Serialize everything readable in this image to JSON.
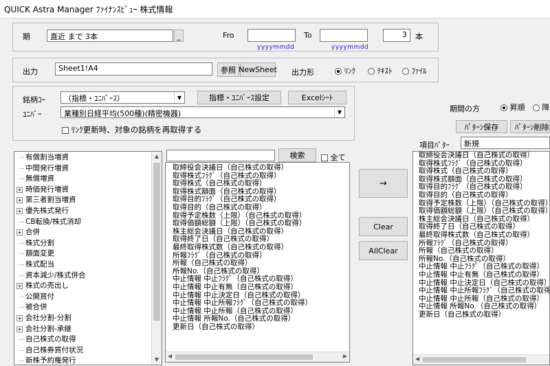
{
  "window": {
    "title": "QUICK Astra Manager ﾌｧｲﾅﾝｽﾋﾞｭｰ 株式情報"
  },
  "period": {
    "label": "期",
    "value": "直近 まで 3本",
    "picker_button": "_",
    "from_label": "Fro",
    "from_value": "",
    "from_hint": "yyyymmdd",
    "to_label": "To",
    "to_value": "",
    "to_hint": "yyyymmdd",
    "count_value": "3",
    "count_unit": "本"
  },
  "output": {
    "label": "出力",
    "value": "Sheet1!A4",
    "browse_button": "参照",
    "newsheet_button": "NewSheet",
    "format_label": "出力形",
    "format_options": [
      "ﾘﾝｸ",
      "ﾃｷｽﾄ",
      "ﾌｧｲﾙ"
    ],
    "format_selected": "ﾘﾝｸ"
  },
  "security": {
    "code_label": "銘柄ｺｰ",
    "code_value": "（指標・ﾕﾆﾊﾞｰｽ）",
    "universe_setting_button": "指標・ﾕﾆﾊﾞｰｽ設定",
    "excel_sheet_button": "Excelｼｰﾄ",
    "universe_label": "ﾕﾆﾊﾞｰ",
    "universe_value": "業種別日経平均(500種)(精密機器)",
    "reacquire_label": "ﾘﾝｸ更新時、対象の銘柄を再取得する"
  },
  "order": {
    "label": "期間の方",
    "options": [
      "昇順",
      "降"
    ],
    "selected": "昇順",
    "save_pattern_button": "ﾊﾟﾀｰﾝ保存",
    "delete_pattern_button": "ﾊﾟﾀｰﾝ削除",
    "item_pattern_label": "項目ﾊﾟﾀｰ",
    "item_pattern_value": "新規"
  },
  "search": {
    "value": "",
    "button": "検索",
    "all_label": "全て"
  },
  "tree": {
    "items": [
      {
        "label": "有償割当増資",
        "expandable": false
      },
      {
        "label": "中間発行増資",
        "expandable": false
      },
      {
        "label": "無償増資",
        "expandable": false
      },
      {
        "label": "時価発行増資",
        "expandable": true
      },
      {
        "label": "第三者割当増資",
        "expandable": true
      },
      {
        "label": "優先株式発行",
        "expandable": true
      },
      {
        "label": "CB転換/株式消却",
        "expandable": false
      },
      {
        "label": "合併",
        "expandable": true
      },
      {
        "label": "株式分割",
        "expandable": false
      },
      {
        "label": "額面変更",
        "expandable": false
      },
      {
        "label": "株式配当",
        "expandable": false
      },
      {
        "label": "資本減少/株式併合",
        "expandable": false
      },
      {
        "label": "株式の売出し",
        "expandable": true
      },
      {
        "label": "公開買付",
        "expandable": false
      },
      {
        "label": "被合併",
        "expandable": false
      },
      {
        "label": "会社分割-分割",
        "expandable": true
      },
      {
        "label": "会社分割-承継",
        "expandable": true
      },
      {
        "label": "自己株式の取得",
        "expandable": false
      },
      {
        "label": "自己株券買付状況",
        "expandable": false
      },
      {
        "label": "新株予約権発行",
        "expandable": false
      }
    ]
  },
  "available_items": [
    "取締役会決議日（自己株式の取得）",
    "取得株式ﾌﾗｸﾞ（自己株式の取得）",
    "取得株式（自己株式の取得）",
    "取得株式額面（自己株式の取得）",
    "取得目的ﾌﾗｸﾞ（自己株式の取得）",
    "取得目的（自己株式の取得）",
    "取得予定株数（上限）（自己株式の取得）",
    "取得価額総額（上限）（自己株式の取得）",
    "株主総会決議日（自己株式の取得）",
    "取得終了日（自己株式の取得）",
    "最終取得株式数（自己株式の取得）",
    "所報ﾌﾗｸﾞ（自己株式の取得）",
    "所報（自己株式の取得）",
    "所報No.（自己株式の取得）",
    "中止情報 中止ﾌﾗｸﾞ（自己株式の取得）",
    "中止情報 中止有無（自己株式の取得）",
    "中止情報 中止決定日（自己株式の取得）",
    "中止情報 中止所報ﾌﾗｸﾞ（自己株式の取得）",
    "中止情報 中止所報（自己株式の取得）",
    "中止情報 所報No.（自己株式の取得）",
    "更新日（自己株式の取得）"
  ],
  "transfer": {
    "add_button": "→",
    "clear_button": "Clear",
    "allclear_button": "AllClear"
  },
  "selected_items": [
    "取締役会決議日（自己株式の取得）",
    "取得株式ﾌﾗｸﾞ（自己株式の取得）",
    "取得株式（自己株式の取得）",
    "取得株式額面（自己株式の取得）",
    "取得目的ﾌﾗｸﾞ（自己株式の取得）",
    "取得目的（自己株式の取得）",
    "取得予定株数（上限）（自己株式の取得）",
    "取得価額総額（上限）（自己株式の取得）",
    "株主総会決議日（自己株式の取得）",
    "取得終了日（自己株式の取得）",
    "最終取得株式数（自己株式の取得）",
    "所報ﾌﾗｸﾞ（自己株式の取得）",
    "所報（自己株式の取得）",
    "所報No.（自己株式の取得）",
    "中止情報 中止ﾌﾗｸﾞ（自己株式の取得）",
    "中止情報 中止有無（自己株式の取得）",
    "中止情報 中止決定日（自己株式の取得）",
    "中止情報 中止所報ﾌﾗｸﾞ（自己株式の取得）",
    "中止情報 中止所報（自己株式の取得）",
    "中止情報 所報No.（自己株式の取得）",
    "更新日（自己株式の取得）"
  ]
}
